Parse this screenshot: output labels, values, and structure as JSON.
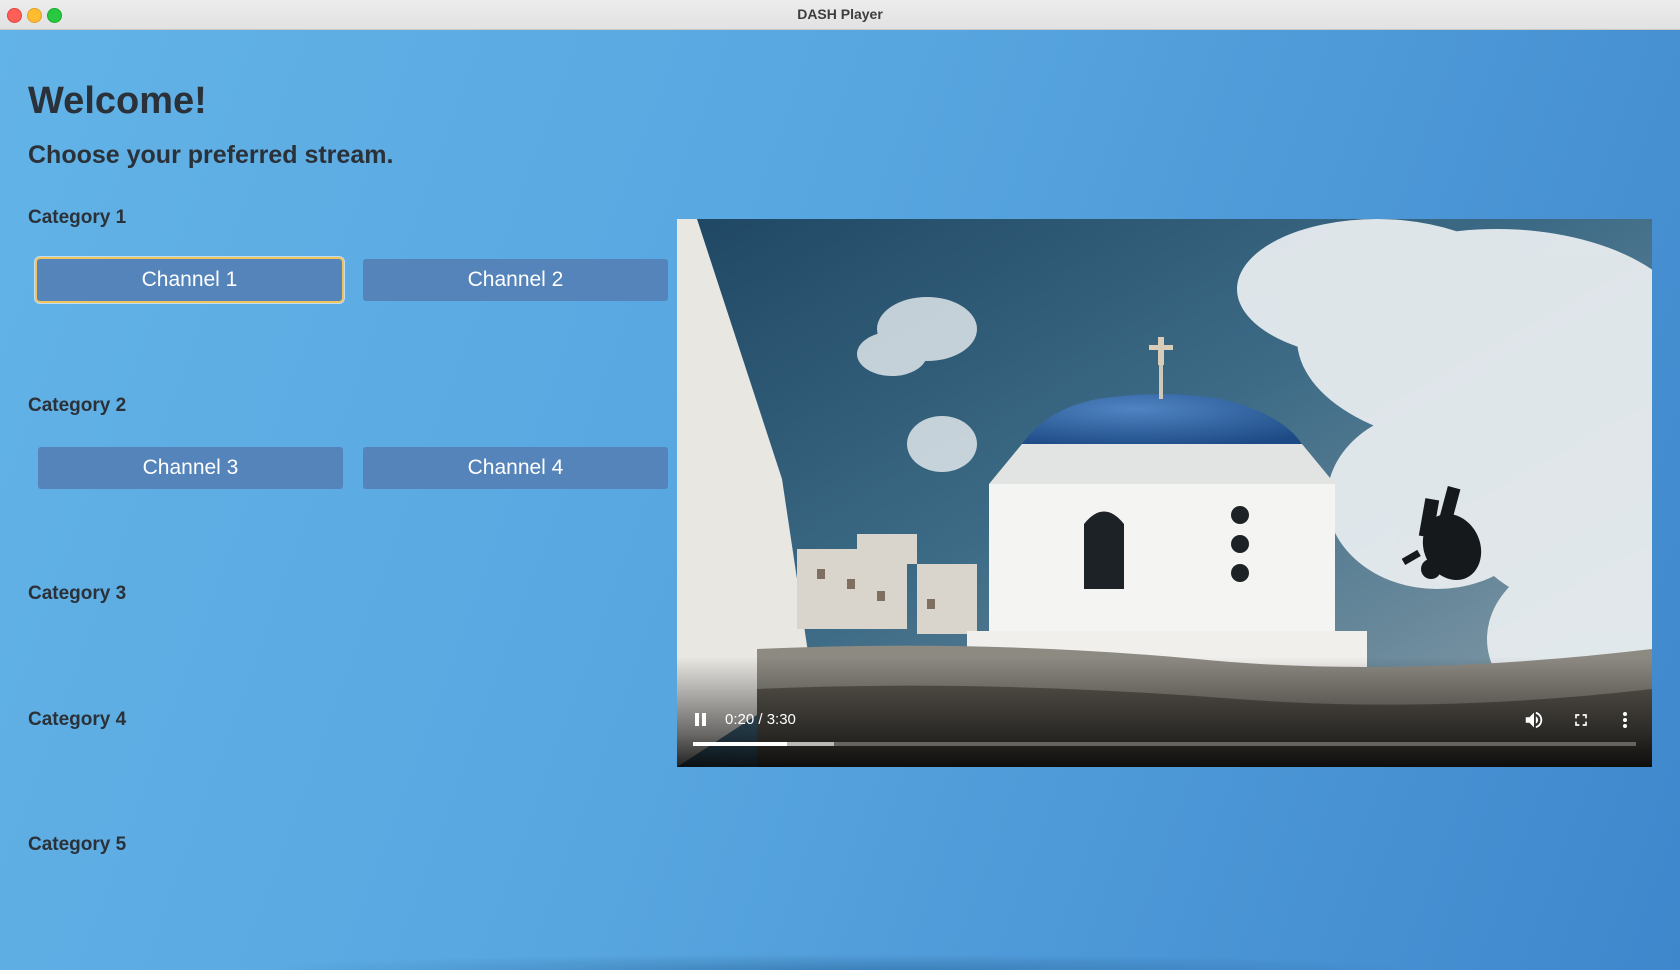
{
  "window": {
    "title": "DASH Player"
  },
  "page": {
    "heading": "Welcome!",
    "subheading": "Choose your preferred stream."
  },
  "categories": [
    {
      "label": "Category 1",
      "channels": [
        "Channel 1",
        "Channel 2"
      ]
    },
    {
      "label": "Category 2",
      "channels": [
        "Channel 3",
        "Channel 4"
      ]
    },
    {
      "label": "Category 3",
      "channels": []
    },
    {
      "label": "Category 4",
      "channels": []
    },
    {
      "label": "Category 5",
      "channels": []
    }
  ],
  "focused_channel": "Channel 1",
  "player": {
    "time_display": "0:20 / 3:30",
    "played_fraction": 0.1,
    "buffered_fraction": 0.15,
    "state": "playing",
    "icons": [
      "pause-icon",
      "volume-icon",
      "fullscreen-icon",
      "more-vert-icon"
    ]
  },
  "colors": {
    "background_start": "#62b3e7",
    "background_end": "#3f87cc",
    "channel_button": "#5584ba",
    "focus_ring": "#f2c35a",
    "heading_text": "#2b3138"
  }
}
